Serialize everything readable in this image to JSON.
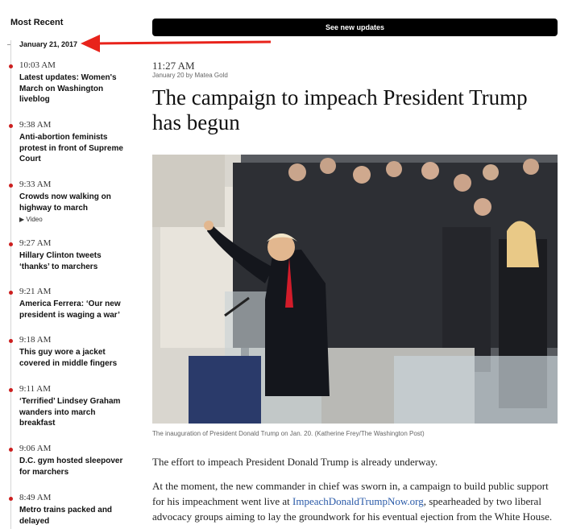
{
  "sidebar": {
    "title": "Most Recent",
    "date": "January 21, 2017",
    "entries": [
      {
        "time": "10:03 AM",
        "headline": "Latest updates: Women's March on Washington liveblog"
      },
      {
        "time": "9:38 AM",
        "headline": "Anti-abortion feminists protest in front of Supreme Court"
      },
      {
        "time": "9:33 AM",
        "headline": "Crowds now walking on highway to march",
        "video": "▶ Video"
      },
      {
        "time": "9:27 AM",
        "headline": "Hillary Clinton tweets ‘thanks’ to marchers"
      },
      {
        "time": "9:21 AM",
        "headline": "America Ferrera: ‘Our new president is waging a war’"
      },
      {
        "time": "9:18 AM",
        "headline": "This guy wore a jacket covered in middle fingers"
      },
      {
        "time": "9:11 AM",
        "headline": "‘Terrified’ Lindsey Graham wanders into march breakfast"
      },
      {
        "time": "9:06 AM",
        "headline": "D.C. gym hosted sleepover for marchers"
      },
      {
        "time": "8:49 AM",
        "headline": "Metro trains packed and delayed"
      }
    ]
  },
  "updates_button": "See new updates",
  "post": {
    "time": "11:27 AM",
    "byline": "January 20 by Matea Gold",
    "title": "The campaign to impeach President Trump has begun",
    "caption": "The inauguration of President Donald Trump on Jan. 20. (Katherine Frey/The Washington Post)",
    "p1": "The effort to impeach President Donald Trump is already underway.",
    "p2_before": "At the moment, the new commander in chief was sworn in, a campaign to build public support for his impeachment went live at ",
    "p2_link": "ImpeachDonaldTrumpNow.org",
    "p2_after": ", spearheaded by two liberal advocacy groups aiming to lay the groundwork for his eventual ejection from the White House."
  },
  "colors": {
    "accent_dot": "#cc1f1f",
    "arrow": "#e8231b",
    "link": "#2a5aa8"
  }
}
